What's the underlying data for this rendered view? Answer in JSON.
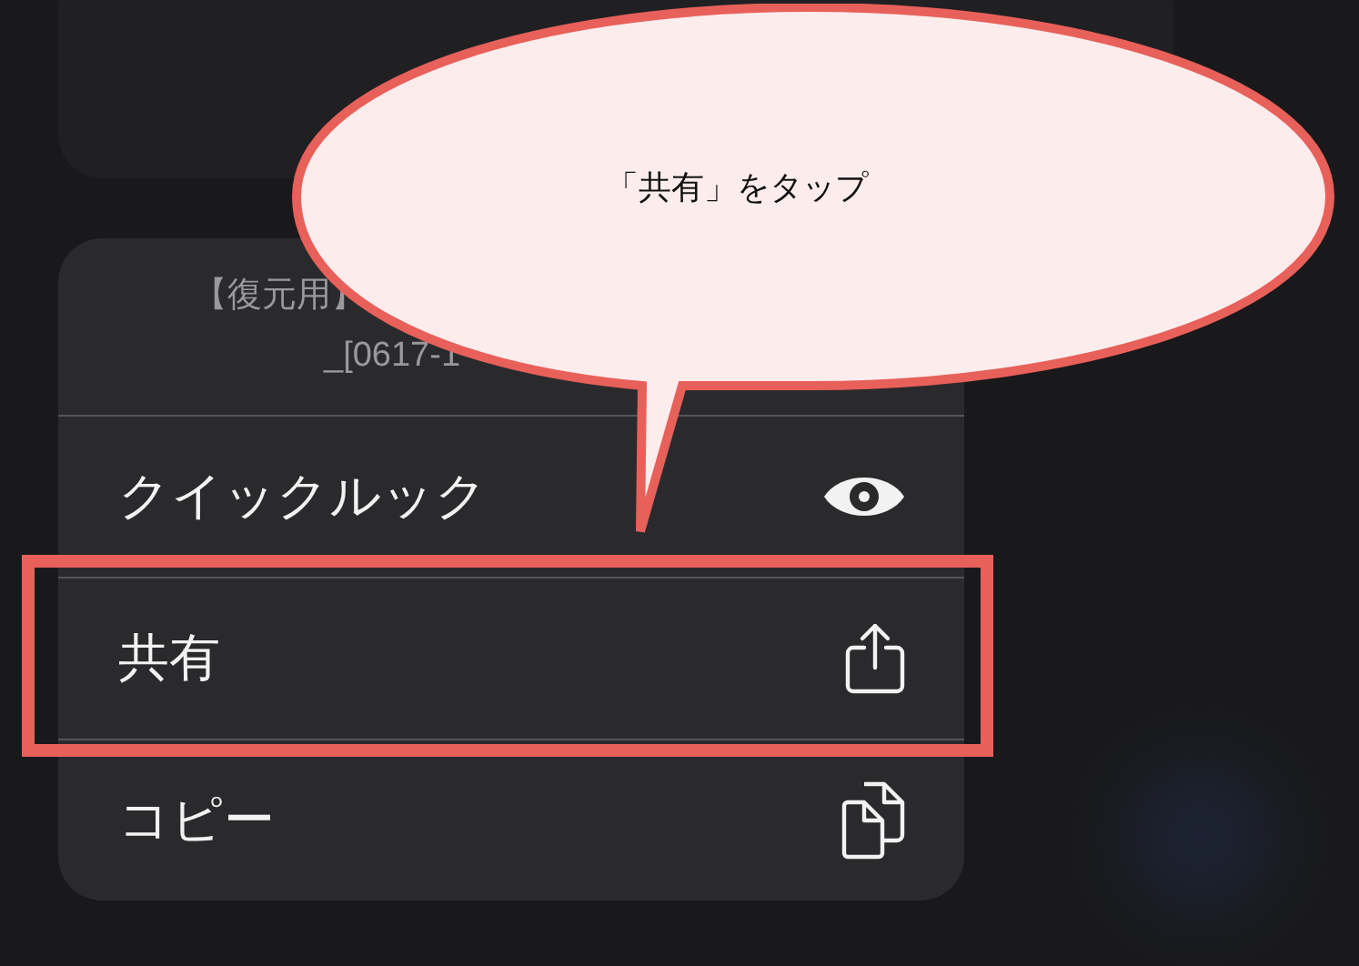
{
  "bubble": {
    "text": "「共有」をタップ"
  },
  "menu": {
    "header": [
      "【復元用】",
      "_[0617-1"
    ],
    "items": [
      {
        "label": "クイックルック",
        "kind": "eye",
        "highlighted": false
      },
      {
        "label": "共有",
        "kind": "share",
        "highlighted": true
      },
      {
        "label": "コピー",
        "kind": "copy",
        "highlighted": false
      }
    ]
  }
}
